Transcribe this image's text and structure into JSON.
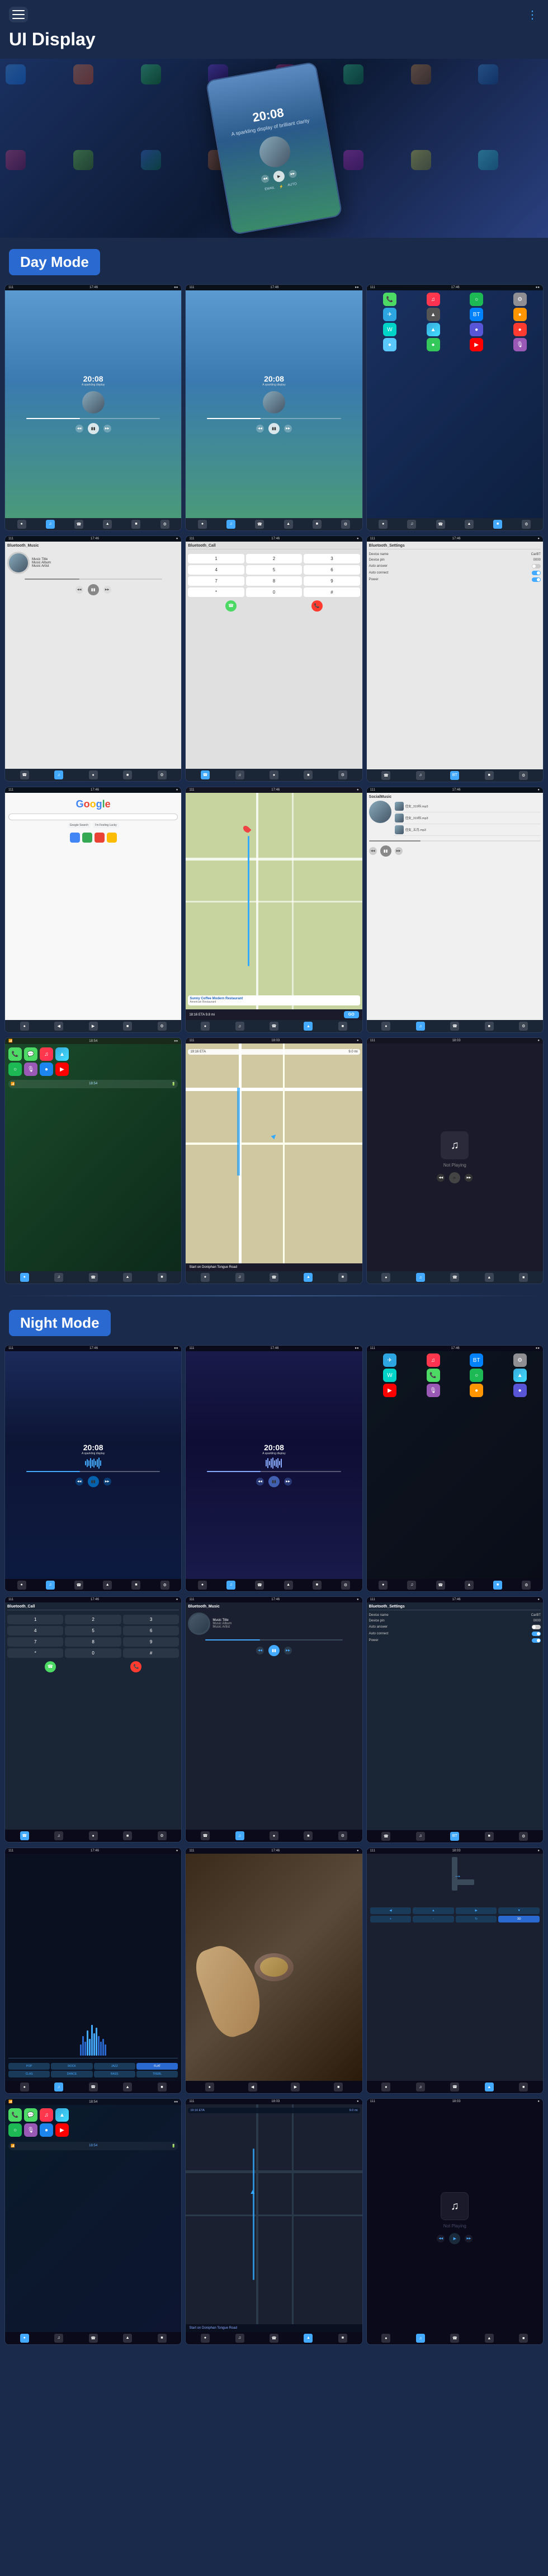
{
  "header": {
    "title": "UI Display",
    "menu_label": "menu",
    "nav_dots": "≡"
  },
  "hero": {
    "time": "20:08",
    "date": "A sparkling display of brilliant clarity"
  },
  "day_mode": {
    "label": "Day Mode"
  },
  "night_mode": {
    "label": "Night Mode"
  },
  "screens": {
    "music1_time": "20:08",
    "music1_date": "A sparkling display",
    "music2_time": "20:08",
    "music2_date": "A sparkling display",
    "bt_music_title": "Bluetooth_Music",
    "bt_call_title": "Bluetooth_Call",
    "bt_settings_title": "Bluetooth_Settings",
    "music_title": "Music Title",
    "music_album": "Music Album",
    "music_artist": "Music Artist",
    "device_name_label": "Device name",
    "device_name_val": "CarBT",
    "device_pin_label": "Device pin",
    "device_pin_val": "0000",
    "auto_answer_label": "Auto answer",
    "auto_connect_label": "Auto connect",
    "power_label": "Power",
    "google_text": "Google",
    "social_music_label": "SocialMusic",
    "sunny_coffee_title": "Sunny Coffee Modern Restaurant",
    "sunny_coffee_subtitle": "American Restaurant",
    "eta_label": "18:16 ETA",
    "eta_val": "9.8 mi",
    "go_btn": "GO",
    "not_playing": "Not Playing",
    "start_label": "Start on Doniphan Tongue Road",
    "dial_keys": [
      "1",
      "2",
      "3",
      "4",
      "5",
      "6",
      "7",
      "8",
      "9",
      "*",
      "0",
      "#"
    ],
    "night_music1_time": "20:08",
    "night_music1_date": "A sparkling display",
    "night_music2_time": "20:08",
    "night_music2_date": "A sparkling display"
  },
  "colors": {
    "accent": "#2a6ad0",
    "bg_dark": "#1a2a4a",
    "day_mode_bg": "#2a6ad0",
    "night_mode_bg": "#2a6ad0"
  }
}
